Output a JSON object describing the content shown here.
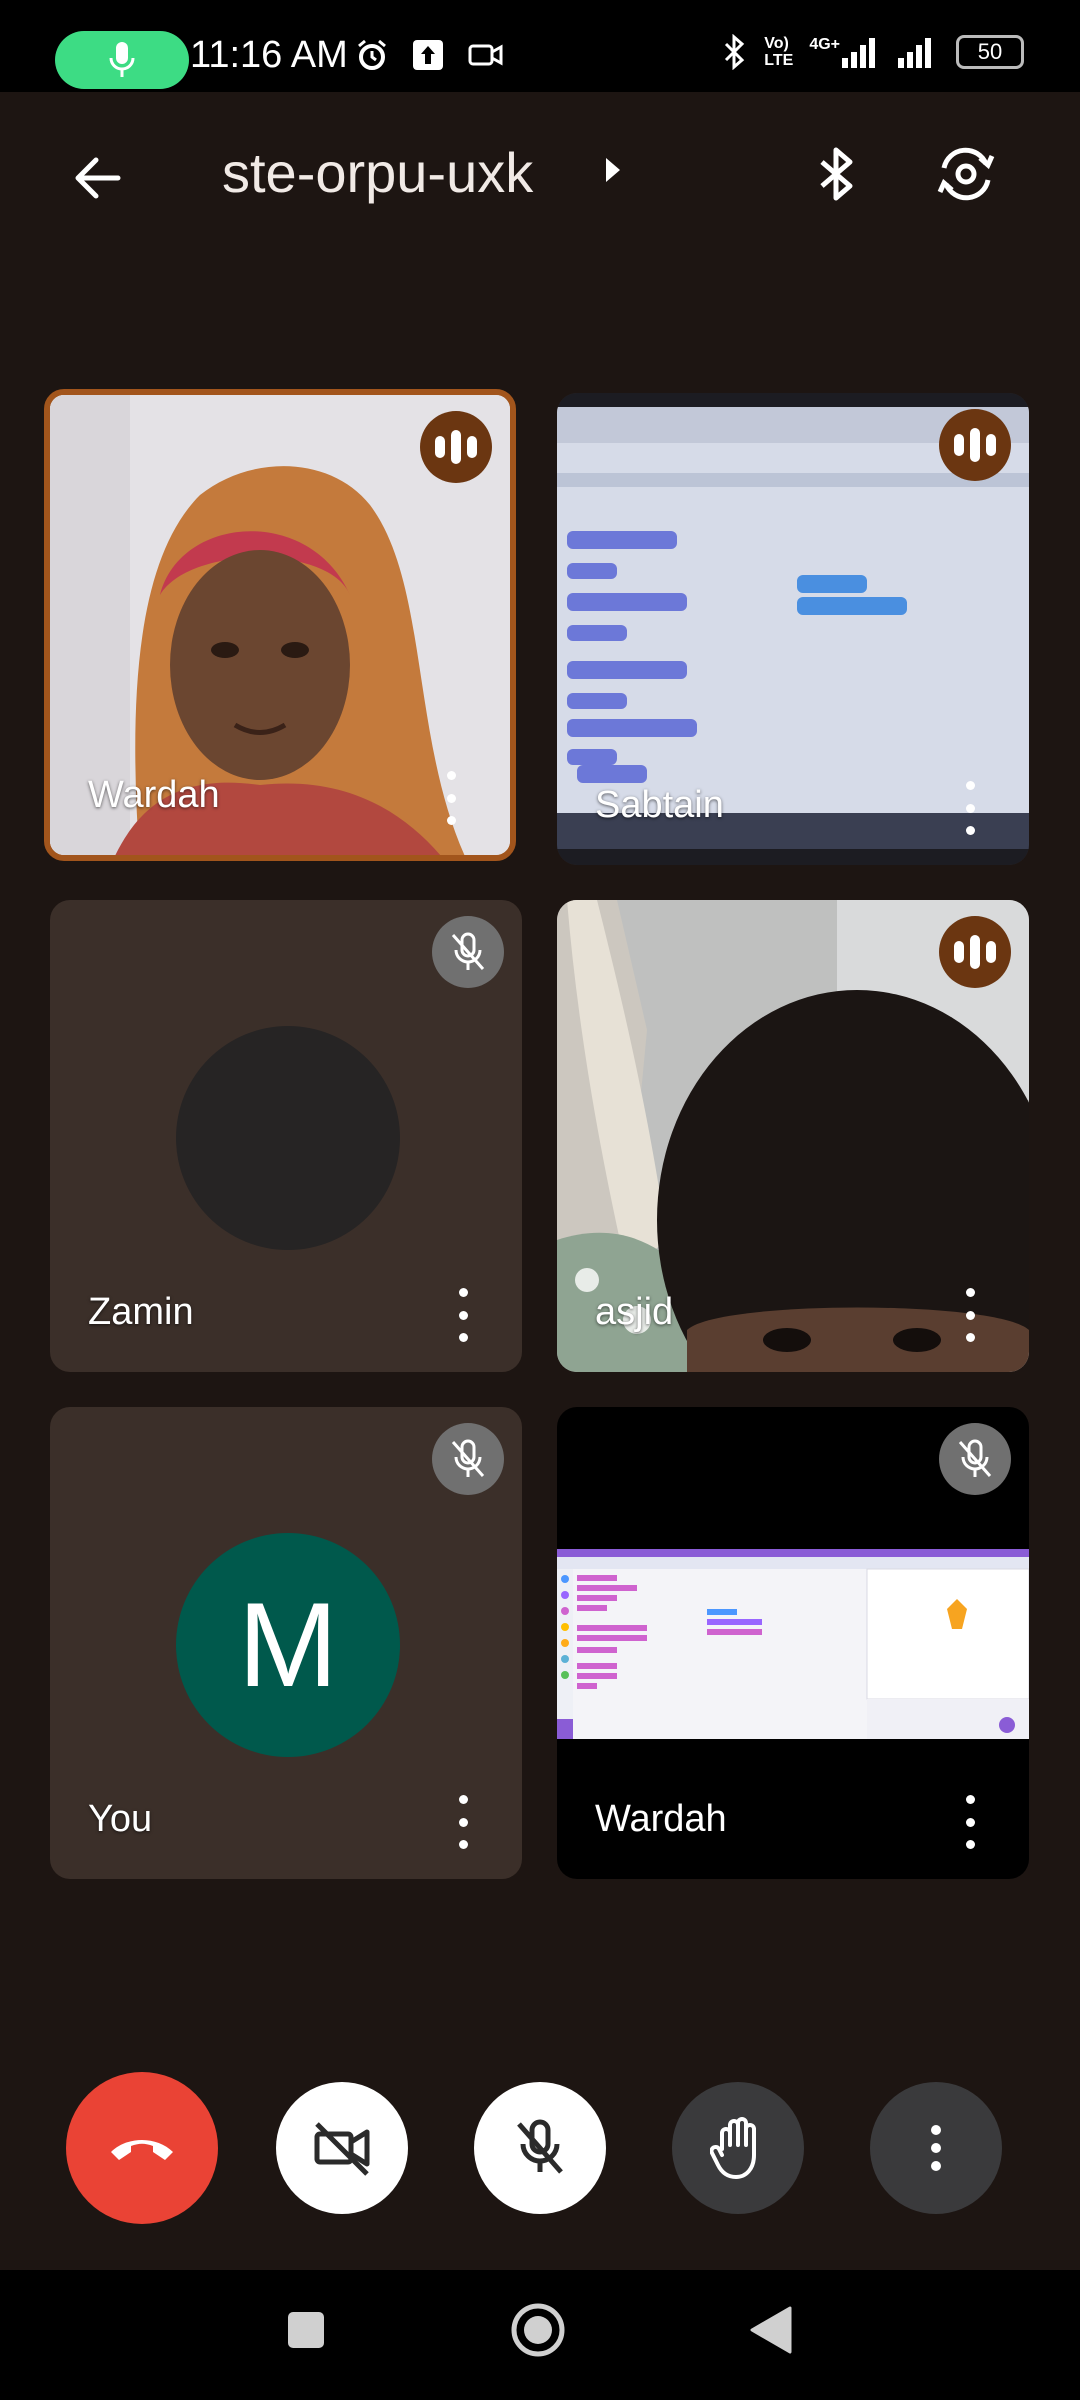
{
  "status_bar": {
    "time": "11:16 AM",
    "network_volte_top": "Vo)",
    "network_volte_bottom": "LTE",
    "network_type": "4G+",
    "battery": "50"
  },
  "app_bar": {
    "meeting_code": "ste-orpu-uxk"
  },
  "participants": [
    {
      "name": "Wardah",
      "state": "speaking",
      "video": "camera"
    },
    {
      "name": "Sabtain",
      "state": "speaking",
      "video": "screen-photo"
    },
    {
      "name": "Zamin",
      "state": "muted",
      "video": "off"
    },
    {
      "name": "asjid",
      "state": "speaking",
      "video": "camera"
    },
    {
      "name": "You",
      "state": "muted",
      "video": "off",
      "avatar_letter": "M"
    },
    {
      "name": "Wardah",
      "state": "muted",
      "video": "screen-share"
    }
  ],
  "colors": {
    "background": "#1d1512",
    "tile": "#3b2f29",
    "speaking_badge": "#6b3611",
    "active_border": "#a2551c",
    "end_call": "#ea4335",
    "avatar_you": "#00594c",
    "mic_pill": "#3ddc84"
  },
  "controls": [
    "end-call",
    "camera-off",
    "mic-off",
    "raise-hand",
    "more-options"
  ]
}
